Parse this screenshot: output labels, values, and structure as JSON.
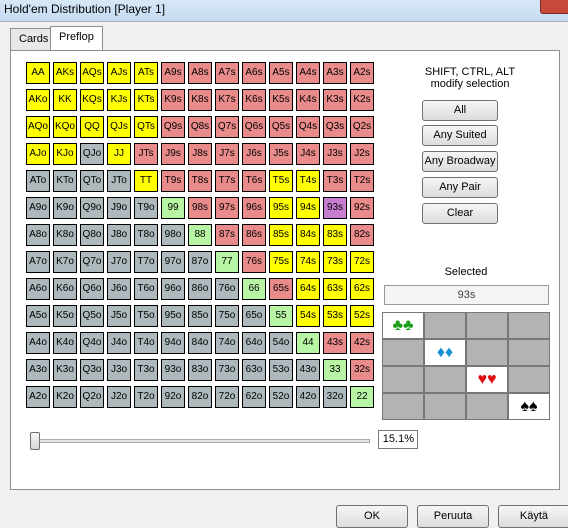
{
  "window": {
    "title": "Hold'em Distribution [Player 1]"
  },
  "tabs": [
    {
      "label": "Cards"
    },
    {
      "label": "Preflop"
    }
  ],
  "grid": {
    "ranks": [
      "A",
      "K",
      "Q",
      "J",
      "T",
      "9",
      "8",
      "7",
      "6",
      "5",
      "4",
      "3",
      "2"
    ],
    "selected_pairs": [
      "AA",
      "KK",
      "QQ",
      "JJ",
      "TT",
      "99",
      "88",
      "77",
      "66",
      "55",
      "44",
      "33",
      "22"
    ],
    "selected_suited": [
      "AKs",
      "AQs",
      "AJs",
      "ATs",
      "KQs",
      "KJs",
      "KTs",
      "QJs",
      "QTs",
      "T5s",
      "T4s",
      "95s",
      "94s",
      "85s",
      "84s",
      "83s",
      "75s",
      "74s",
      "73s",
      "72s",
      "64s",
      "63s",
      "62s",
      "54s",
      "53s",
      "52s"
    ],
    "selected_offsuit": [
      "AKo",
      "AQo",
      "KQo",
      "AJo",
      "KJo",
      "TT"
    ],
    "highlight": [
      "93s"
    ]
  },
  "info": {
    "line1": "SHIFT, CTRL, ALT",
    "line2": "modify selection"
  },
  "buttons": {
    "all": "All",
    "any_suited": "Any Suited",
    "any_broadway": "Any Broadway",
    "any_pair": "Any Pair",
    "clear": "Clear"
  },
  "selected": {
    "label": "Selected",
    "value": "93s"
  },
  "slider": {
    "percent": "15.1%"
  },
  "footer": {
    "ok": "OK",
    "cancel": "Peruuta",
    "apply": "Käytä"
  },
  "suits": [
    "♣♣",
    "♦♦",
    "♥♥",
    "♠♠"
  ]
}
